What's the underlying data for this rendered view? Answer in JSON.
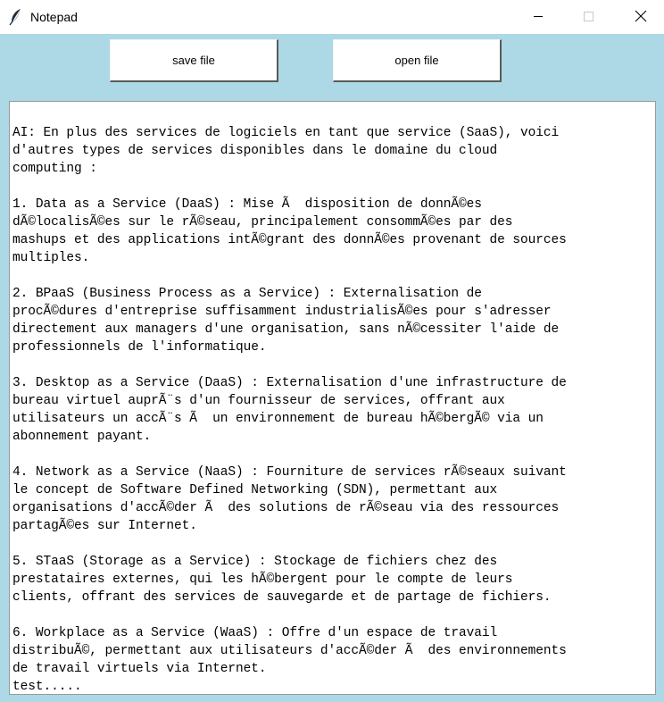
{
  "window": {
    "title": "Notepad",
    "app_icon": "feather-icon",
    "controls": [
      "minimize-icon",
      "maximize-icon",
      "close-icon"
    ]
  },
  "toolbar": {
    "save_label": "save file",
    "open_label": "open file"
  },
  "editor": {
    "content": "AI: En plus des services de logiciels en tant que service (SaaS), voici\nd'autres types de services disponibles dans le domaine du cloud\ncomputing :\n\n1. Data as a Service (DaaS) : Mise Ã  disposition de donnÃ©es\ndÃ©localisÃ©es sur le rÃ©seau, principalement consommÃ©es par des\nmashups et des applications intÃ©grant des donnÃ©es provenant de sources\nmultiples.\n\n2. BPaaS (Business Process as a Service) : Externalisation de\nprocÃ©dures d'entreprise suffisamment industrialisÃ©es pour s'adresser\ndirectement aux managers d'une organisation, sans nÃ©cessiter l'aide de\nprofessionnels de l'informatique.\n\n3. Desktop as a Service (DaaS) : Externalisation d'une infrastructure de\nbureau virtuel auprÃ¨s d'un fournisseur de services, offrant aux\nutilisateurs un accÃ¨s Ã  un environnement de bureau hÃ©bergÃ© via un\nabonnement payant.\n\n4. Network as a Service (NaaS) : Fourniture de services rÃ©seaux suivant\nle concept de Software Defined Networking (SDN), permettant aux\norganisations d'accÃ©der Ã  des solutions de rÃ©seau via des ressources\npartagÃ©es sur Internet.\n\n5. STaaS (Storage as a Service) : Stockage de fichiers chez des\nprestataires externes, qui les hÃ©bergent pour le compte de leurs\nclients, offrant des services de sauvegarde et de partage de fichiers.\n\n6. Workplace as a Service (WaaS) : Offre d'un espace de travail\ndistribuÃ©, permettant aux utilisateurs d'accÃ©der Ã  des environnements\nde travail virtuels via Internet.\ntest....."
  },
  "colors": {
    "client_background": "#add8e6",
    "button_background": "#ffffff",
    "editor_background": "#ffffff"
  }
}
